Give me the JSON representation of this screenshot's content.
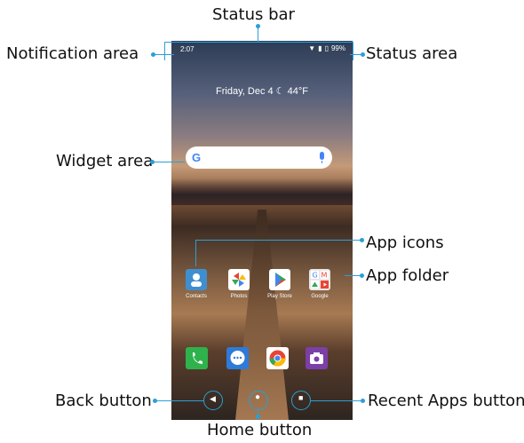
{
  "callouts": {
    "status_bar": "Status bar",
    "notification_area": "Notification area",
    "status_area": "Status area",
    "widget_area": "Widget area",
    "app_icons": "App icons",
    "app_folder": "App folder",
    "back_button": "Back button",
    "home_button": "Home button",
    "recent_apps_button": "Recent Apps button"
  },
  "phone": {
    "status": {
      "time": "2:07",
      "battery": "99%"
    },
    "date_widget": "Friday, Dec 4 ☾ 44°F",
    "search": {
      "logo": "G"
    },
    "apps": [
      {
        "label": "Contacts",
        "icon": "contacts-icon",
        "color": "#3f8fd0"
      },
      {
        "label": "Photos",
        "icon": "photos-icon",
        "color": "#ffffff"
      },
      {
        "label": "Play Store",
        "icon": "play-store-icon",
        "color": "#ffffff"
      },
      {
        "label": "Google",
        "icon": "google-folder-icon",
        "color": "#e8e8e8"
      }
    ],
    "dock": [
      {
        "icon": "phone-icon",
        "color": "#2fb24c"
      },
      {
        "icon": "messages-icon",
        "color": "#2e7ad8"
      },
      {
        "icon": "chrome-icon",
        "color": "#ffffff"
      },
      {
        "icon": "camera-icon",
        "color": "#7b3fa8"
      }
    ]
  },
  "colors": {
    "callout_line": "#2a9fd8"
  }
}
